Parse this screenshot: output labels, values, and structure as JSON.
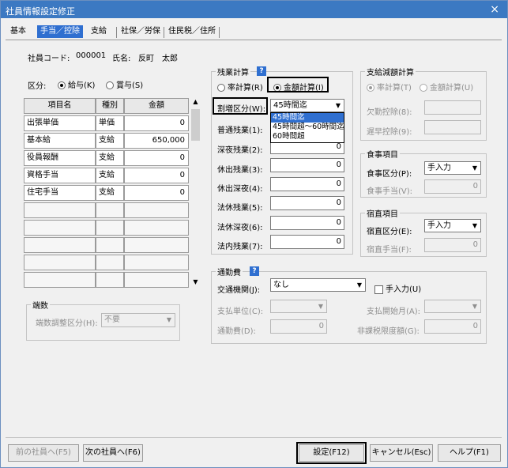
{
  "window": {
    "title": "社員情報設定修正",
    "close": "×"
  },
  "tabs": [
    "基本",
    "手当／控除",
    "支給",
    "社保／労保",
    "住民税／住所"
  ],
  "employee": {
    "code_label": "社員コード:",
    "code": "000001",
    "name_label": "氏名:",
    "name": "反町　太郎"
  },
  "kubun": {
    "label": "区分:",
    "options": [
      "給与(K)",
      "賞与(S)"
    ],
    "selected": "給与(K)"
  },
  "allowance_table": {
    "headers": [
      "項目名",
      "種別",
      "金額"
    ],
    "rows": [
      {
        "name": "出張単価",
        "type": "単価",
        "amount": "0"
      },
      {
        "name": "基本給",
        "type": "支給",
        "amount": "650,000"
      },
      {
        "name": "役員報酬",
        "type": "支給",
        "amount": "0"
      },
      {
        "name": "資格手当",
        "type": "支給",
        "amount": "0"
      },
      {
        "name": "住宅手当",
        "type": "支給",
        "amount": "0"
      }
    ],
    "empty_rows": 5
  },
  "rounding": {
    "title": "端数",
    "label": "端数調整区分(H):",
    "value": "不要"
  },
  "overtime": {
    "title": "残業計算",
    "help": "?",
    "options": [
      "率計算(R)",
      "金額計算(I)"
    ],
    "selected": "金額計算(I)",
    "warimashi_label": "割増区分(W):",
    "warimashi_value": "45時間迄",
    "dropdown_options": [
      "45時間迄",
      "45時間超～60時間迄",
      "60時間超"
    ],
    "dropdown_selected": "45時間迄",
    "fields": [
      {
        "label": "普通残業(1):",
        "value": "0"
      },
      {
        "label": "深夜残業(2):",
        "value": "0"
      },
      {
        "label": "休出残業(3):",
        "value": "0"
      },
      {
        "label": "休出深夜(4):",
        "value": "0"
      },
      {
        "label": "法休残業(5):",
        "value": "0"
      },
      {
        "label": "法休深夜(6):",
        "value": "0"
      },
      {
        "label": "法内残業(7):",
        "value": "0"
      }
    ]
  },
  "reduction": {
    "title": "支給減額計算",
    "options": [
      "率計算(T)",
      "金額計算(U)"
    ],
    "selected": "率計算(T)",
    "fields": [
      {
        "label": "欠勤控除(8):",
        "value": ""
      },
      {
        "label": "遅早控除(9):",
        "value": ""
      }
    ]
  },
  "meal": {
    "title": "食事項目",
    "kubun_label": "食事区分(P):",
    "kubun_value": "手入力",
    "teate_label": "食事手当(V):",
    "teate_value": "0"
  },
  "night": {
    "title": "宿直項目",
    "kubun_label": "宿直区分(E):",
    "kubun_value": "手入力",
    "teate_label": "宿直手当(F):",
    "teate_value": "0"
  },
  "commute": {
    "title": "通勤費",
    "help": "?",
    "kikan_label": "交通機関(J):",
    "kikan_value": "なし",
    "manual_label": "手入力(U)",
    "unit_label": "支払単位(C):",
    "unit_value": "",
    "start_label": "支払開始月(A):",
    "start_value": "",
    "fee_label": "通勤費(D):",
    "fee_value": "0",
    "limit_label": "非課税限度額(G):",
    "limit_value": "0"
  },
  "buttons": {
    "prev": "前の社員へ(F5)",
    "next": "次の社員へ(F6)",
    "set": "設定(F12)",
    "cancel": "キャンセル(Esc)",
    "help": "ヘルプ(F1)"
  }
}
